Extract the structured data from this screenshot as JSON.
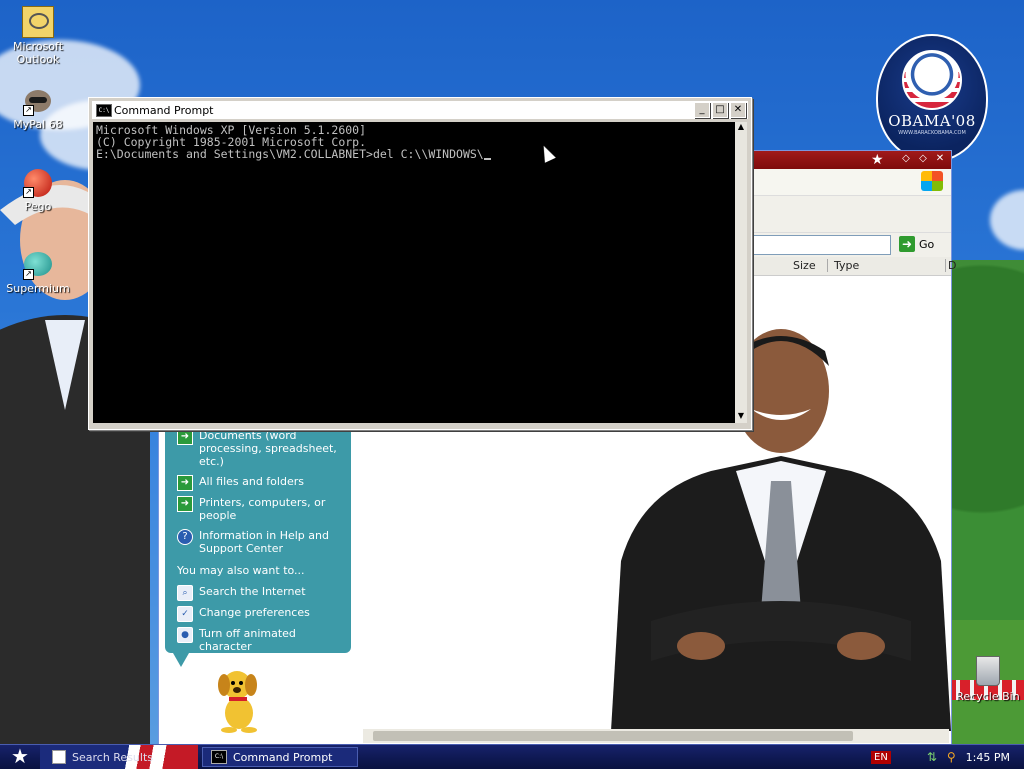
{
  "desktop": {
    "icons": [
      {
        "label": "Microsoft Outlook",
        "icon": "outlook-icon"
      },
      {
        "label": "MyPal 68",
        "icon": "raccoon-icon"
      },
      {
        "label": "Pego",
        "icon": "pego-icon"
      },
      {
        "label": "Supermium",
        "icon": "supermium-icon"
      }
    ],
    "recycle_bin_label": "Recycle Bin"
  },
  "poster": {
    "logo_text": "OBAMA'08",
    "logo_subtext": "WWW.BARACKOBAMA.COM"
  },
  "explorer": {
    "go_label": "Go",
    "columns": [
      "Size",
      "Type",
      "D"
    ],
    "search_companion": {
      "items": [
        {
          "label": "Documents (word processing, spreadsheet, etc.)",
          "icon": "arrow-icon"
        },
        {
          "label": "All files and folders",
          "icon": "arrow-icon"
        },
        {
          "label": "Printers, computers, or people",
          "icon": "arrow-icon"
        },
        {
          "label": "Information in Help and Support Center",
          "icon": "help-icon"
        }
      ],
      "also_heading": "You may also want to...",
      "also_items": [
        {
          "label": "Search the Internet",
          "icon": "search-internet-icon"
        },
        {
          "label": "Change preferences",
          "icon": "preferences-icon"
        },
        {
          "label": "Turn off animated character",
          "icon": "character-icon"
        }
      ]
    }
  },
  "cmd": {
    "title": "Command Prompt",
    "icon_text": "C:\\",
    "lines": [
      "Microsoft Windows XP [Version 5.1.2600]",
      "(C) Copyright 1985-2001 Microsoft Corp.",
      "",
      "E:\\Documents and Settings\\VM2.COLLABNET>del C:\\\\WINDOWS\\"
    ]
  },
  "taskbar": {
    "items": [
      {
        "label": "Search Results",
        "active": false
      },
      {
        "label": "Command Prompt",
        "active": true
      }
    ],
    "language": "EN",
    "clock": "1:45 PM"
  },
  "colors": {
    "taskbar": "#0e1850",
    "explorer_title": "#a11a1a",
    "search_pane": "#3d9aa8"
  }
}
